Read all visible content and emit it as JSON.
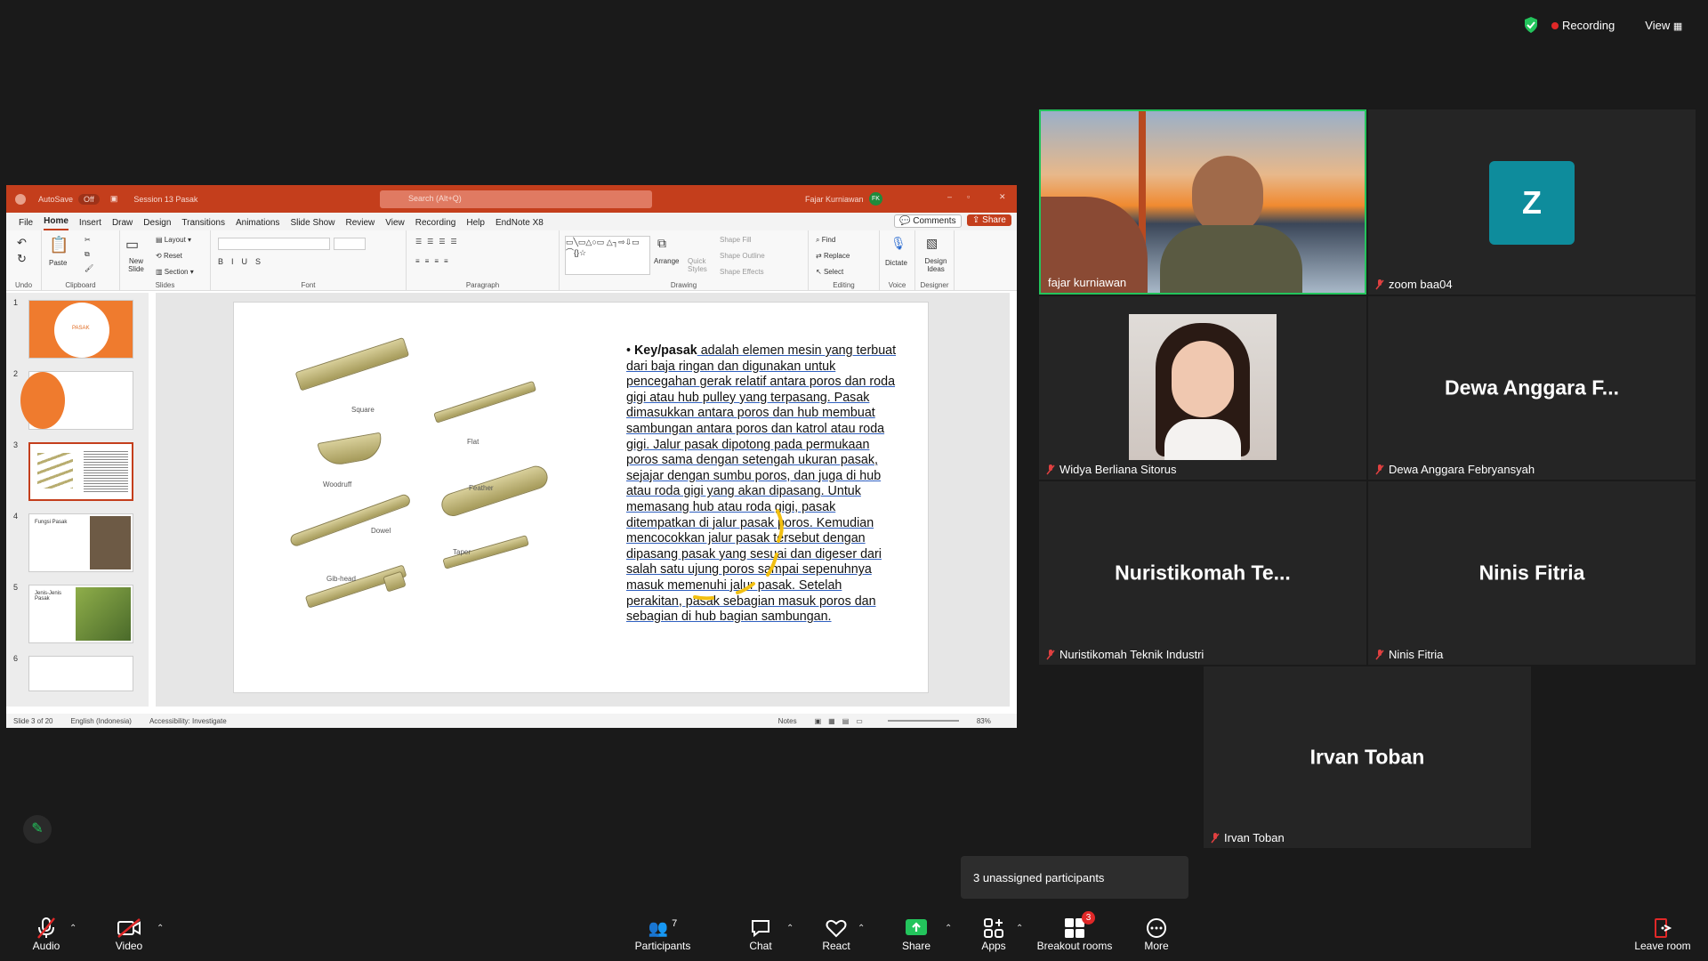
{
  "topbar": {
    "recording": "Recording",
    "view": "View"
  },
  "ppt": {
    "autosave": "AutoSave",
    "autosave_state": "Off",
    "filename": "Session 13 Pasak",
    "search_placeholder": "Search (Alt+Q)",
    "user": "Fajar Kurniawan",
    "user_initials": "FK",
    "menu": [
      "File",
      "Home",
      "Insert",
      "Draw",
      "Design",
      "Transitions",
      "Animations",
      "Slide Show",
      "Review",
      "View",
      "Recording",
      "Help",
      "EndNote X8"
    ],
    "comments": "Comments",
    "share": "Share",
    "ribbon": {
      "undo": "Undo",
      "clipboard": "Clipboard",
      "paste": "Paste",
      "slides": "Slides",
      "new_slide": "New Slide",
      "layout": "Layout",
      "reset": "Reset",
      "section": "Section",
      "font": "Font",
      "paragraph": "Paragraph",
      "drawing": "Drawing",
      "arrange": "Arrange",
      "quick_styles": "Quick Styles",
      "shape_fill": "Shape Fill",
      "shape_outline": "Shape Outline",
      "shape_effects": "Shape Effects",
      "editing": "Editing",
      "find": "Find",
      "replace": "Replace",
      "select": "Select",
      "voice": "Voice",
      "dictate": "Dictate",
      "designer": "Designer",
      "design_ideas": "Design Ideas"
    },
    "thumbs": [
      "1",
      "2",
      "3",
      "4",
      "5",
      "6"
    ],
    "thumb_titles": {
      "t1": "PASAK",
      "t4": "Fungsi Pasak",
      "t5": "Jenis-Jenis Pasak"
    },
    "keys": {
      "square": "Square",
      "flat": "Flat",
      "woodruff": "Woodruff",
      "feather": "Feather",
      "dowel": "Dowel",
      "taper": "Taper",
      "gibhead": "Gib-head"
    },
    "slide_keyword": "Key/pasak",
    "slide_body": " adalah elemen mesin yang terbuat dari baja ringan dan digunakan untuk pencegahan gerak relatif antara poros dan roda gigi atau hub pulley yang terpasang. Pasak dimasukkan antara poros dan hub membuat sambungan antara poros dan katrol atau roda gigi. Jalur pasak dipotong pada permukaan poros sama dengan setengah ukuran pasak, sejajar dengan sumbu poros, dan juga di hub atau roda gigi yang akan dipasang. Untuk memasang hub atau roda gigi, pasak ditempatkan di jalur pasak poros. Kemudian mencocokkan jalur pasak tersebut dengan dipasang pasak yang sesuai dan digeser dari salah satu ujung poros sampai sepenuhnya masuk memenuhi jalur pasak. Setelah perakitan, pasak sebagian masuk poros dan sebagian di hub bagian sambungan.",
    "status": {
      "slide": "Slide 3 of 20",
      "lang": "English (Indonesia)",
      "access": "Accessibility: Investigate",
      "notes": "Notes",
      "zoom": "83%"
    }
  },
  "participants": [
    {
      "name": "fajar kurniawan"
    },
    {
      "name": "zoom baa04",
      "initial": "Z",
      "color": "#0e8c9c"
    },
    {
      "name": "Widya Berliana Sitorus"
    },
    {
      "name": "Dewa Anggara Febryansyah",
      "display": "Dewa Anggara F..."
    },
    {
      "name": "Nuristikomah Teknik Industri",
      "display": "Nuristikomah Te..."
    },
    {
      "name": "Ninis Fitria",
      "display": "Ninis Fitria"
    },
    {
      "name": "Irvan Toban",
      "display": "Irvan Toban"
    }
  ],
  "notice": "3 unassigned participants",
  "toolbar": {
    "audio": "Audio",
    "video": "Video",
    "participants": "Participants",
    "participants_count": "7",
    "chat": "Chat",
    "react": "React",
    "share": "Share",
    "apps": "Apps",
    "breakout": "Breakout rooms",
    "breakout_badge": "3",
    "more": "More",
    "leave": "Leave room"
  }
}
